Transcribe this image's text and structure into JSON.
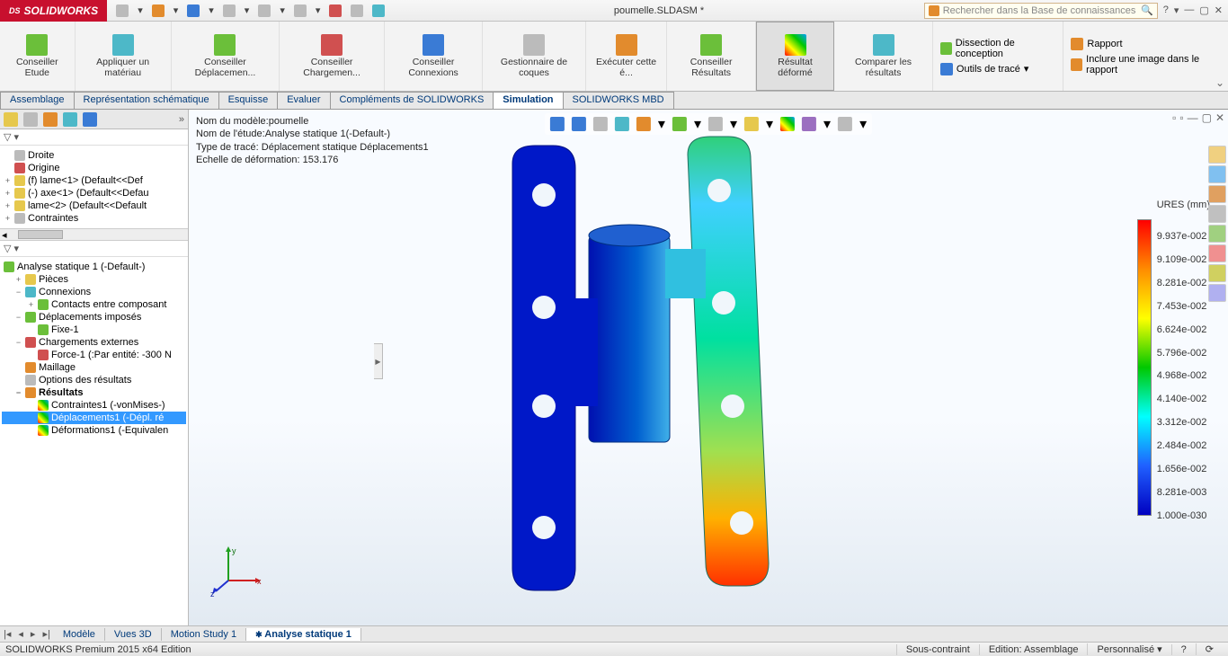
{
  "title": "poumelle.SLDASM *",
  "search_placeholder": "Rechercher dans la Base de connaissances",
  "qat": [
    "new",
    "open",
    "save",
    "print",
    "undo",
    "select",
    "rebuild",
    "options",
    "doc-props"
  ],
  "ribbon": {
    "groups": [
      {
        "label": "Conseiller Etude",
        "icon": "magnifier"
      },
      {
        "label": "Appliquer un matériau",
        "icon": "material"
      },
      {
        "label": "Conseiller Déplacemen...",
        "icon": "advisor"
      },
      {
        "label": "Conseiller Chargemen...",
        "icon": "advisor"
      },
      {
        "label": "Conseiller Connexions",
        "icon": "advisor"
      },
      {
        "label": "Gestionnaire de coques",
        "icon": "shell"
      },
      {
        "label": "Exécuter cette é...",
        "icon": "run"
      },
      {
        "label": "Conseiller Résultats",
        "icon": "advisor"
      },
      {
        "label": "Résultat déformé",
        "icon": "deformed",
        "selected": true
      },
      {
        "label": "Comparer les résultats",
        "icon": "compare"
      }
    ],
    "small": [
      {
        "label": "Dissection de conception",
        "icon": "dissect"
      },
      {
        "label": "Outils de tracé",
        "icon": "plot-tools"
      }
    ],
    "small2": [
      {
        "label": "Rapport",
        "icon": "report"
      },
      {
        "label": "Inclure une image dans le rapport",
        "icon": "image-report"
      }
    ]
  },
  "tabs": [
    {
      "label": "Assemblage"
    },
    {
      "label": "Représentation schématique"
    },
    {
      "label": "Esquisse"
    },
    {
      "label": "Evaluer"
    },
    {
      "label": "Compléments de SOLIDWORKS"
    },
    {
      "label": "Simulation",
      "active": true
    },
    {
      "label": "SOLIDWORKS MBD"
    }
  ],
  "feature_tree": [
    {
      "label": "Droite",
      "icon": "plane"
    },
    {
      "label": "Origine",
      "icon": "origin"
    },
    {
      "label": "(f) lame<1> (Default<<Def",
      "icon": "part"
    },
    {
      "label": "(-) axe<1> (Default<<Defau",
      "icon": "part"
    },
    {
      "label": "lame<2> (Default<<Default",
      "icon": "part"
    },
    {
      "label": "Contraintes",
      "icon": "mates"
    }
  ],
  "sim_tree": {
    "study": "Analyse statique 1 (-Default-)",
    "nodes": [
      {
        "label": "Pièces",
        "icon": "parts",
        "exp": "+",
        "indent": 1
      },
      {
        "label": "Connexions",
        "icon": "connections",
        "exp": "-",
        "indent": 1
      },
      {
        "label": "Contacts entre composant",
        "icon": "contact",
        "exp": "+",
        "indent": 2
      },
      {
        "label": "Déplacements imposés",
        "icon": "fixtures",
        "exp": "-",
        "indent": 1
      },
      {
        "label": "Fixe-1",
        "icon": "fixed",
        "indent": 2
      },
      {
        "label": "Chargements externes",
        "icon": "loads",
        "exp": "-",
        "indent": 1
      },
      {
        "label": "Force-1 (:Par entité: -300 N",
        "icon": "force",
        "indent": 2
      },
      {
        "label": "Maillage",
        "icon": "mesh",
        "indent": 1
      },
      {
        "label": "Options des résultats",
        "icon": "result-opts",
        "indent": 1
      },
      {
        "label": "Résultats",
        "icon": "results",
        "exp": "-",
        "indent": 1,
        "bold": true
      },
      {
        "label": "Contraintes1 (-vonMises-)",
        "icon": "plot",
        "indent": 2
      },
      {
        "label": "Déplacements1 (-Dépl. ré",
        "icon": "plot",
        "indent": 2,
        "selected": true
      },
      {
        "label": "Déformations1 (-Equivalen",
        "icon": "plot",
        "indent": 2
      }
    ]
  },
  "info": {
    "l1": "Nom du modèle:poumelle",
    "l2": "Nom de l'étude:Analyse statique 1(-Default-)",
    "l3": "Type de tracé: Déplacement statique Déplacements1",
    "l4": "Echelle de déformation: 153.176"
  },
  "legend": {
    "title": "URES (mm)",
    "values": [
      "9.937e-002",
      "9.109e-002",
      "8.281e-002",
      "7.453e-002",
      "6.624e-002",
      "5.796e-002",
      "4.968e-002",
      "4.140e-002",
      "3.312e-002",
      "2.484e-002",
      "1.656e-002",
      "8.281e-003",
      "1.000e-030"
    ]
  },
  "bottom_tabs": [
    {
      "label": "Modèle"
    },
    {
      "label": "Vues 3D"
    },
    {
      "label": "Motion Study 1"
    },
    {
      "label": "Analyse statique 1",
      "active": true
    }
  ],
  "status": {
    "left": "SOLIDWORKS Premium 2015 x64 Edition",
    "s1": "Sous-contraint",
    "s2": "Edition: Assemblage",
    "s3": "Personnalisé"
  }
}
